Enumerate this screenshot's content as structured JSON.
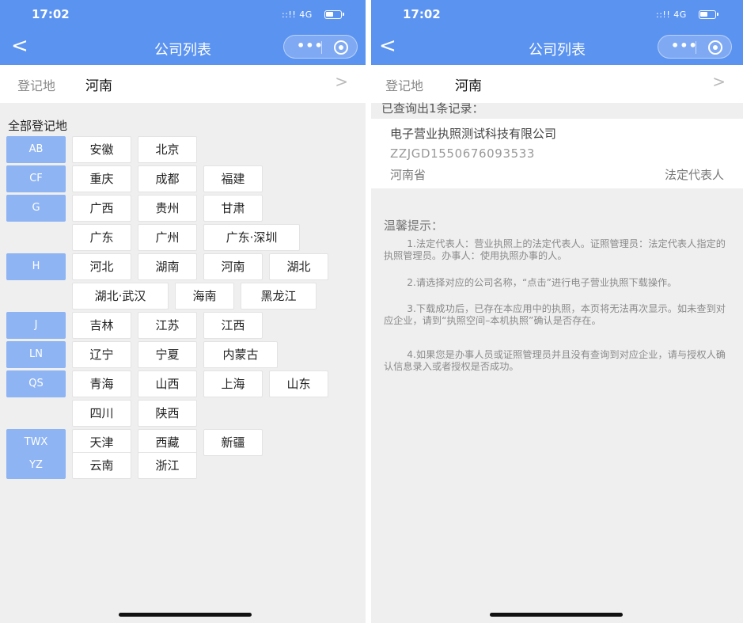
{
  "left": {
    "status": {
      "time": "17:02",
      "signal": "::!! 4G"
    },
    "nav": {
      "back": "<",
      "title": "公司列表",
      "more": "•••"
    },
    "registration": {
      "label": "登记地",
      "value": "河南",
      "chevron": ">"
    },
    "section_title": "全部登记地",
    "groups": [
      {
        "letter": "AB",
        "cities": [
          "安徽",
          "北京"
        ]
      },
      {
        "letter": "CF",
        "cities": [
          "重庆",
          "成都",
          "福建"
        ]
      },
      {
        "letter": "G",
        "cities": [
          "广西",
          "贵州",
          "甘肃"
        ]
      },
      {
        "letter": "",
        "cities": [
          "广东",
          "广州",
          "广东·深圳"
        ]
      },
      {
        "letter": "H",
        "cities": [
          "河北",
          "湖南",
          "河南",
          "湖北"
        ]
      },
      {
        "letter": "",
        "cities": [
          "湖北·武汉",
          "海南",
          "黑龙江"
        ]
      },
      {
        "letter": "J",
        "cities": [
          "吉林",
          "江苏",
          "江西"
        ]
      },
      {
        "letter": "LN",
        "cities": [
          "辽宁",
          "宁夏",
          "内蒙古"
        ]
      },
      {
        "letter": "QS",
        "cities": [
          "青海",
          "山西",
          "上海",
          "山东"
        ]
      },
      {
        "letter": "",
        "cities": [
          "四川",
          "陕西"
        ]
      },
      {
        "letter": "TWX",
        "cities": [
          "天津",
          "西藏",
          "新疆"
        ]
      },
      {
        "letter": "YZ",
        "cities": [
          "云南",
          "浙江"
        ]
      }
    ]
  },
  "right": {
    "status": {
      "time": "17:02",
      "signal": "::!! 4G"
    },
    "nav": {
      "back": "<",
      "title": "公司列表",
      "more": "•••"
    },
    "registration": {
      "label": "登记地",
      "value": "河南",
      "chevron": ">"
    },
    "result_count": "已查询出1条记录：",
    "result": {
      "company": "电子营业执照测试科技有限公司",
      "code": "ZZJGD1550676093533",
      "province": "河南省",
      "role": "法定代表人"
    },
    "tips_title": "温馨提示：",
    "tips": [
      "1.法定代表人：营业执照上的法定代表人。证照管理员：法定代表人指定的执照管理员。办事人：使用执照办事的人。",
      "2.请选择对应的公司名称，“点击”进行电子营业执照下载操作。",
      "3.下载成功后，已存在本应用中的执照，本页将无法再次显示。如未查到对应企业，请到“执照空间–本机执照”确认是否存在。",
      "4.如果您是办事人员或证照管理员并且没有查询到对应企业，请与授权人确认信息录入或者授权是否成功。"
    ]
  },
  "colors": {
    "nav_blue": "#5b93f0",
    "letter_blue": "#8eb4f3",
    "page_bg": "#efefef"
  }
}
